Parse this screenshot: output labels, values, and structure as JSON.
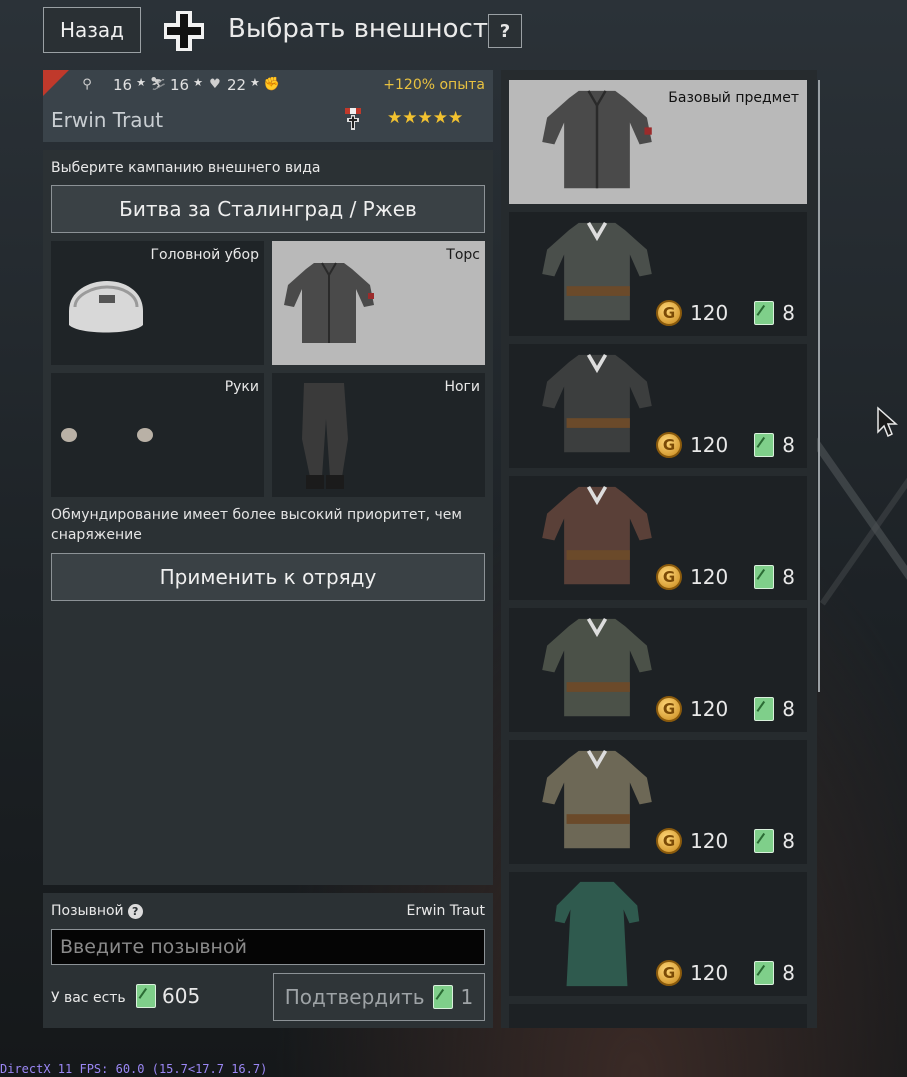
{
  "header": {
    "back_label": "Назад",
    "title": "Выбрать внешность",
    "help_label": "?"
  },
  "soldier": {
    "stats": [
      "16",
      "16",
      "22"
    ],
    "xp_bonus": "+120% опыта",
    "name": "Erwin Traut",
    "stars": "★★★★★"
  },
  "appearance": {
    "campaign_prompt": "Выберите кампанию внешнего вида",
    "campaign_value": "Битва за Сталинград / Ржев",
    "slots": {
      "head": "Головной убор",
      "torso": "Торс",
      "hands": "Руки",
      "legs": "Ноги"
    },
    "priority_note": "Обмундирование имеет более высокий приоритет, чем снаряжение",
    "apply_label": "Применить к отряду"
  },
  "callsign": {
    "label": "Позывной",
    "help": "?",
    "current": "Erwin Traut",
    "placeholder": "Введите позывной",
    "value": "",
    "have_label": "У вас есть",
    "have_amount": "605",
    "confirm_label": "Подтвердить",
    "confirm_cost": "1"
  },
  "items": {
    "base_label": "Базовый предмет",
    "list": [
      {
        "gold": "120",
        "tickets": "8",
        "color": "#4a4f4b"
      },
      {
        "gold": "120",
        "tickets": "8",
        "color": "#3c3e3e"
      },
      {
        "gold": "120",
        "tickets": "8",
        "color": "#5a4038"
      },
      {
        "gold": "120",
        "tickets": "8",
        "color": "#4b5148"
      },
      {
        "gold": "120",
        "tickets": "8",
        "color": "#6d6856"
      },
      {
        "gold": "120",
        "tickets": "8",
        "color": "#2f5a4e"
      }
    ]
  },
  "debug": {
    "fps_text": "DirectX 11 FPS: 60.0 (15.7<17.7 16.7)"
  }
}
